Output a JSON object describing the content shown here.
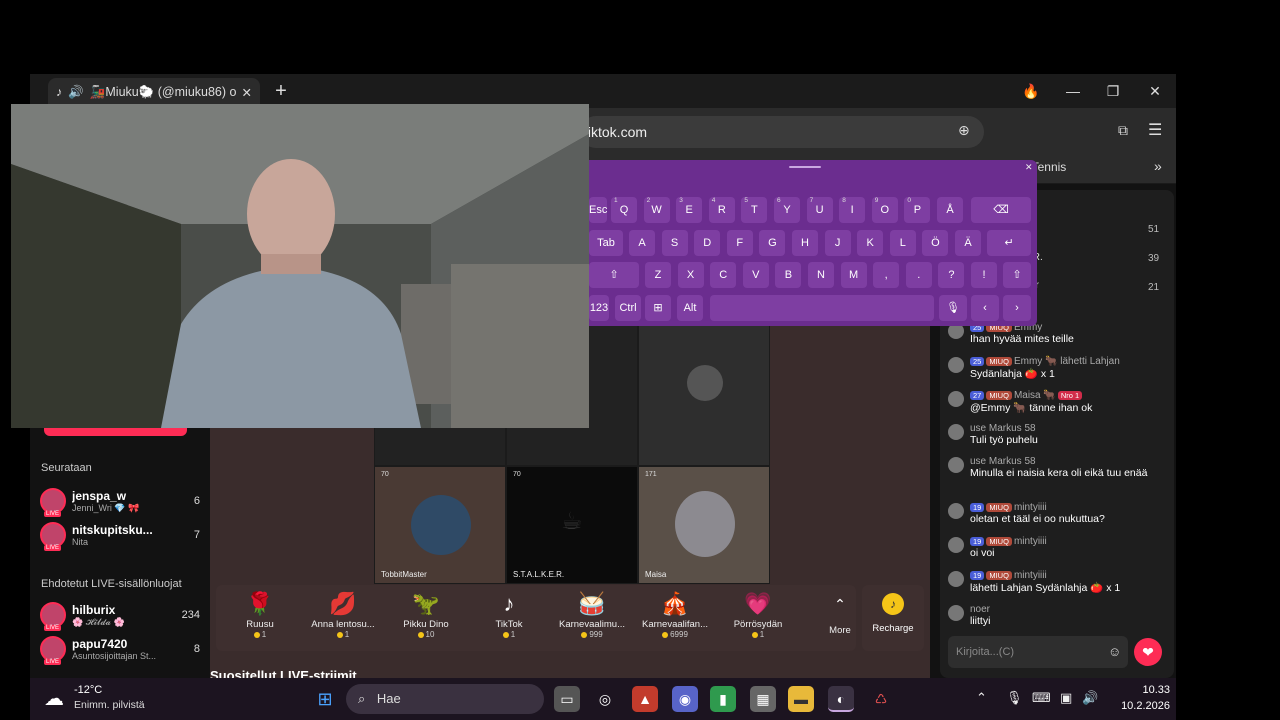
{
  "browser": {
    "tab_title": "🚂Miuku🐑 (@miuku86) o",
    "url": "tiktok.com",
    "bookmark_tennis": "Tennis"
  },
  "leftnav": {
    "following_heading": "Seurataan",
    "following": [
      {
        "name": "jenspa_w",
        "sub": "Jenni_Wri 💎 🎀",
        "count": "6"
      },
      {
        "name": "nitskupitsku...",
        "sub": "Nita",
        "count": "7"
      }
    ],
    "suggested_heading": "Ehdotetut LIVE-sisällönluojat",
    "suggested": [
      {
        "name": "hilburix",
        "sub": "🌸 𝓗𝓲𝓵𝓭𝓪 🌸",
        "count": "234"
      },
      {
        "name": "papu7420",
        "sub": "Asuntosijoittajan St...",
        "count": "8"
      }
    ],
    "live_badge": "LIVE"
  },
  "stage": {
    "cells": [
      {
        "label": "TobbitMaster",
        "count": "70"
      },
      {
        "label": "S.T.A.L.K.E.R.",
        "count": "70"
      },
      {
        "label": "Maisa",
        "count": "171"
      }
    ]
  },
  "gifts": [
    {
      "icon": "🌹",
      "name": "Ruusu",
      "price": "1"
    },
    {
      "icon": "💋",
      "name": "Anna lentosu...",
      "price": "1"
    },
    {
      "icon": "🦖",
      "name": "Pikku Dino",
      "price": "10"
    },
    {
      "icon": "♪",
      "name": "TikTok",
      "price": "1"
    },
    {
      "icon": "🥁",
      "name": "Karnevaalimu...",
      "price": "999"
    },
    {
      "icon": "🎪",
      "name": "Karnevaalifan...",
      "price": "6999"
    },
    {
      "icon": "💗",
      "name": "Pörrösydän",
      "price": "1"
    }
  ],
  "more_label": "More",
  "recharge_label": "Recharge",
  "recommended_heading": "Suositellut LIVE-striimit",
  "ranking": [
    {
      "count": "51"
    },
    {
      "name": ".R.",
      "count": "39"
    },
    {
      "name": "or",
      "count": "21"
    }
  ],
  "chat": {
    "messages": [
      {
        "level": "25",
        "fan": "MIUQ",
        "user": "Emmy",
        "text": "Ihan hyvää mites teille"
      },
      {
        "level": "25",
        "fan": "MIUQ",
        "user": "Emmy 🐂 lähetti Lahjan",
        "text": "Sydänlahja 🍅 x 1"
      },
      {
        "level": "27",
        "fan": "MIUQ",
        "user": "Maisa 🐂",
        "badge": "Nro 1",
        "text": "@Emmy 🐂 tänne ihan ok"
      },
      {
        "user": "use Markus 58",
        "text": "Tuli työ puhelu"
      },
      {
        "user": "use Markus 58",
        "text": "Minulla ei naisia kera oli eikä tuu enää"
      },
      {
        "level": "19",
        "fan": "MIUQ",
        "user": "mintyiiii",
        "text": "oletan et tääl ei oo nukuttua?"
      },
      {
        "level": "19",
        "fan": "MIUQ",
        "user": "mintyiiii",
        "text": "oi voi"
      },
      {
        "level": "19",
        "fan": "MIUQ",
        "user": "mintyiiii",
        "text": "lähetti Lahjan Sydänlahja 🍅 x 1"
      },
      {
        "user": "noer",
        "text": "liittyi"
      }
    ],
    "input_placeholder": "Kirjoita...(C)"
  },
  "keyboard": {
    "row1": [
      [
        "Esc",
        ""
      ],
      [
        "Q",
        "1"
      ],
      [
        "W",
        "2"
      ],
      [
        "E",
        "3"
      ],
      [
        "R",
        "4"
      ],
      [
        "T",
        "5"
      ],
      [
        "Y",
        "6"
      ],
      [
        "U",
        "7"
      ],
      [
        "I",
        "8"
      ],
      [
        "O",
        "9"
      ],
      [
        "P",
        "0"
      ],
      [
        "Å",
        ""
      ]
    ],
    "row2": [
      "Tab",
      "A",
      "S",
      "D",
      "F",
      "G",
      "H",
      "J",
      "K",
      "L",
      "Ö",
      "Ä"
    ],
    "row3": [
      "⇧",
      "Z",
      "X",
      "C",
      "V",
      "B",
      "N",
      "M",
      ",",
      ".",
      "?",
      "!"
    ],
    "row4": [
      "123",
      "Ctrl",
      "⊞",
      "Alt"
    ]
  },
  "taskbar": {
    "temperature": "-12°C",
    "weather": "Enimm. pilvistä",
    "search": "Hae",
    "time": "10.33",
    "date": "10.2.2026"
  },
  "colors": {
    "accent": "#fe2c55",
    "keyboard": "#6b2d8f",
    "taskbar": "#1c1420"
  }
}
